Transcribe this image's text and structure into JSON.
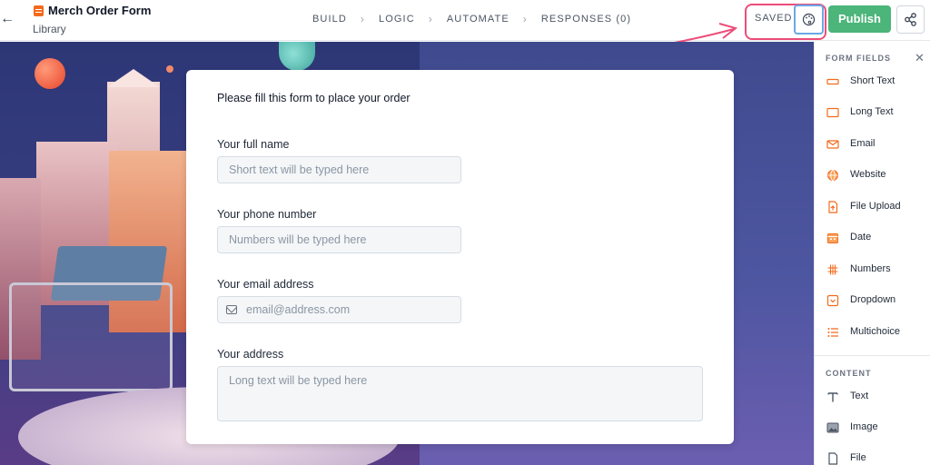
{
  "header": {
    "form_title": "Merch Order Form",
    "library": "Library",
    "steps": [
      "BUILD",
      "LOGIC",
      "AUTOMATE",
      "RESPONSES (0)"
    ],
    "saved": "SAVED",
    "publish": "Publish",
    "icons": {
      "back": "arrow-left-icon",
      "form": "form-icon",
      "theme": "palette-icon",
      "share": "share-icon"
    }
  },
  "form": {
    "intro": "Please fill this form to place your order",
    "questions": [
      {
        "label": "Your full name",
        "placeholder": "Short text will be typed here"
      },
      {
        "label": "Your phone number",
        "placeholder": "Numbers will be typed here"
      },
      {
        "label": "Your email address",
        "placeholder": "email@address.com"
      },
      {
        "label": "Your address",
        "placeholder": "Long text will be typed here"
      }
    ]
  },
  "panel": {
    "form_fields_title": "FORM FIELDS",
    "content_title": "CONTENT",
    "form_fields": [
      {
        "label": "Short Text",
        "icon": "short-text-icon"
      },
      {
        "label": "Long Text",
        "icon": "long-text-icon"
      },
      {
        "label": "Email",
        "icon": "email-icon"
      },
      {
        "label": "Website",
        "icon": "globe-icon"
      },
      {
        "label": "File Upload",
        "icon": "file-upload-icon"
      },
      {
        "label": "Date",
        "icon": "calendar-icon"
      },
      {
        "label": "Numbers",
        "icon": "numbers-icon"
      },
      {
        "label": "Dropdown",
        "icon": "dropdown-icon"
      },
      {
        "label": "Multichoice",
        "icon": "multichoice-icon"
      }
    ],
    "content": [
      {
        "label": "Text",
        "icon": "text-icon"
      },
      {
        "label": "Image",
        "icon": "image-icon"
      },
      {
        "label": "File",
        "icon": "file-icon"
      }
    ]
  },
  "colors": {
    "accent_orange": "#f26b1d",
    "publish_green": "#4bb57a",
    "annotation_pink": "#ec4d7a",
    "theme_button_border": "#6aa8e6"
  }
}
